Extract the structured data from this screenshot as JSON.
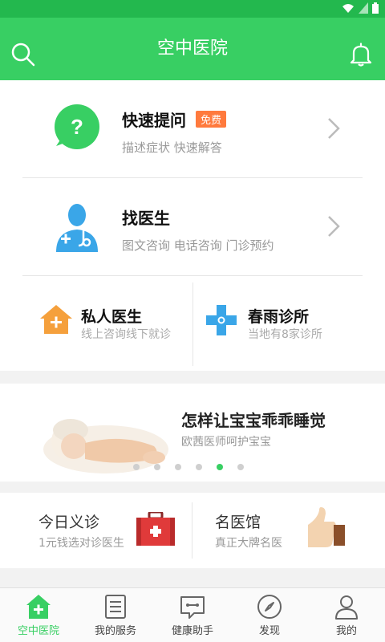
{
  "header": {
    "title": "空中医院"
  },
  "quick_ask": {
    "title": "快速提问",
    "badge": "免费",
    "subtitle": "描述症状 快速解答"
  },
  "find_doctor": {
    "title": "找医生",
    "subtitle": "图文咨询 电话咨询 门诊预约"
  },
  "private_doctor": {
    "title": "私人医生",
    "subtitle": "线上咨询线下就诊"
  },
  "clinic": {
    "title": "春雨诊所",
    "subtitle": "当地有8家诊所"
  },
  "banner": {
    "title": "怎样让宝宝乖乖睡觉",
    "subtitle": "欧茜医师呵护宝宝",
    "dots_total": 6,
    "active_dot": 4
  },
  "free_clinic": {
    "title": "今日义诊",
    "subtitle": "1元钱选对诊医生"
  },
  "famous_hall": {
    "title": "名医馆",
    "subtitle": "真正大牌名医"
  },
  "tabbar": {
    "tabs": [
      "空中医院",
      "我的服务",
      "健康助手",
      "发现",
      "我的"
    ],
    "active": 0
  },
  "colors": {
    "primary": "#38cf63",
    "statusbar": "#23b84e",
    "badge": "#ff7a3d",
    "orange_icon": "#f5a03c",
    "blue_icon": "#3aa6e8"
  }
}
